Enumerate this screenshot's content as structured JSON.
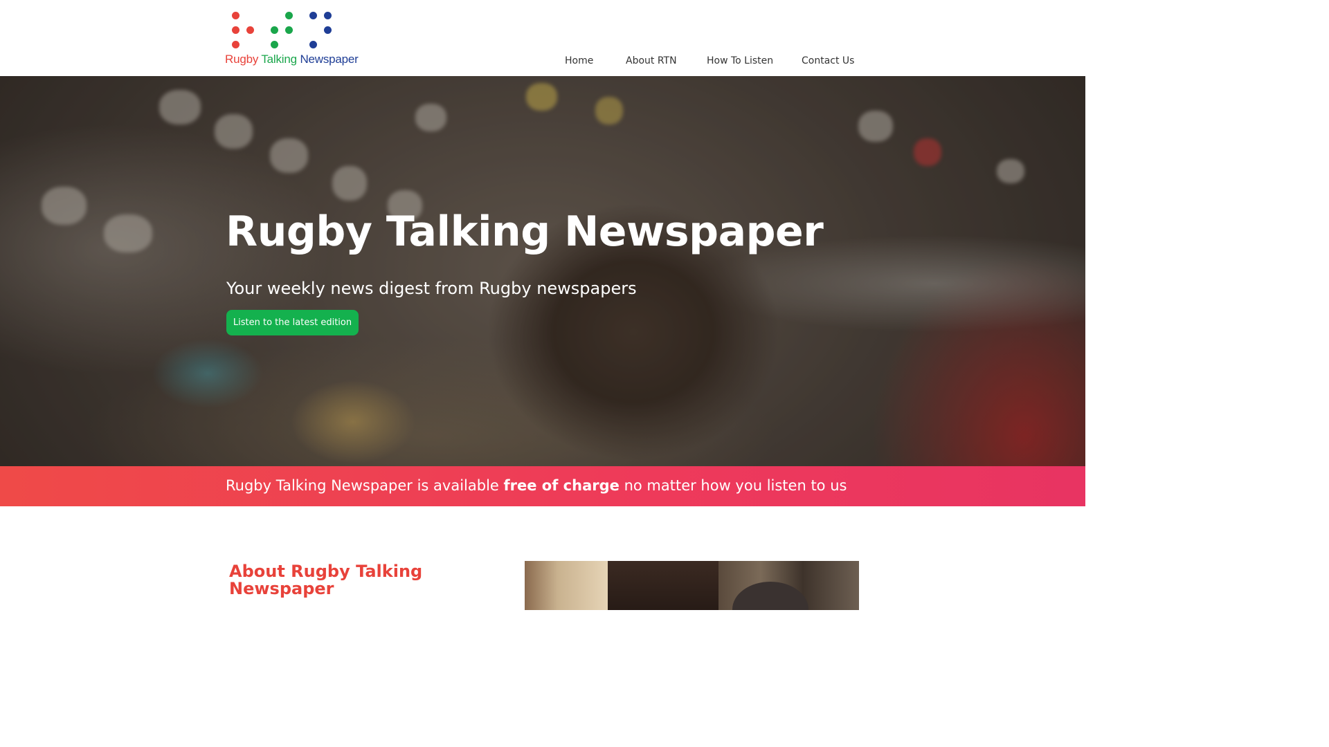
{
  "logo": {
    "word1": "Rugby",
    "word2": "Talking",
    "word3": "Newspaper",
    "colors": {
      "red": "#e8423a",
      "green": "#1aa64b",
      "blue": "#1f3e96"
    }
  },
  "nav": {
    "items": [
      {
        "label": "Home"
      },
      {
        "label": "About RTN"
      },
      {
        "label": "How To Listen"
      },
      {
        "label": "Contact Us"
      }
    ]
  },
  "hero": {
    "title": "Rugby Talking Newspaper",
    "subtitle": "Your weekly news digest from Rugby newspapers",
    "button_label": "Listen to the latest edition",
    "button_color": "#14b14e"
  },
  "banner": {
    "text_before": "Rugby Talking Newspaper is available ",
    "text_bold": "free of charge",
    "text_after": " no matter how you listen to us",
    "color": "#ee3a5a"
  },
  "about": {
    "title": "About Rugby Talking Newspaper",
    "title_color": "#e8423a"
  }
}
